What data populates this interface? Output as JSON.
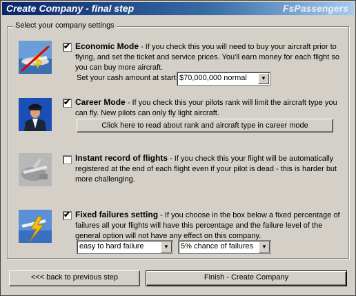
{
  "window": {
    "title": "Create Company - final step",
    "brand": "FsPassengers"
  },
  "group_label": "Select your company settings",
  "options": {
    "economic": {
      "checked": true,
      "heading": "Economic Mode",
      "text": " - If you check this you will need to buy your aircraft prior to flying, and set the ticket and service prices. You'll earn money for each flight so you can buy more aircraft.",
      "cash_label": "Set your cash amount at start:",
      "cash_value": "$70,000,000 normal"
    },
    "career": {
      "checked": true,
      "heading": "Career Mode",
      "text": "  - If you check this your pilots rank will limit the aircraft type you can fly. New pilots can only fly light aircraft.",
      "read_button": "Click here to read about rank and aircraft type in career mode"
    },
    "instant": {
      "checked": false,
      "heading": "Instant record of flights",
      "text": "  - If you check this your flight will be automatically registered at the end of each flight even if your pilot is dead - this is harder but more challenging."
    },
    "failures": {
      "checked": true,
      "heading": "Fixed failures setting",
      "text": "  - If you choose in the box below a fixed percentage of failures all your flights will have this percentage and the failure level of the general option will not have any effect on this company.",
      "level_value": "easy to hard failure",
      "chance_value": "5% chance of failures"
    }
  },
  "buttons": {
    "back": "<<< back to previous step",
    "finish": "Finish - Create Company"
  },
  "colors": {
    "titlebar_start": "#0a246a",
    "titlebar_end": "#a6caf0",
    "face": "#d4d0c8"
  }
}
